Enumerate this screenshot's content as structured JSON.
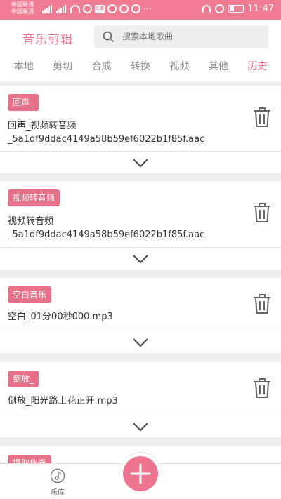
{
  "status_bar": {
    "carrier_1": "中国联通",
    "carrier_2": "中国联通",
    "time": "11:47"
  },
  "header": {
    "title": "音乐剪辑",
    "search_placeholder": "搜索本地歌曲"
  },
  "tabs": [
    {
      "label": "本地"
    },
    {
      "label": "剪切"
    },
    {
      "label": "合成"
    },
    {
      "label": "转换"
    },
    {
      "label": "视频"
    },
    {
      "label": "其他"
    },
    {
      "label": "历史",
      "active": true
    }
  ],
  "items": [
    {
      "tag": "回声_",
      "name_line1": "回声_视频转音频",
      "name_line2": "_5a1df9ddac4149a58b59ef6022b1f85f.aac"
    },
    {
      "tag": "视频转音频",
      "name_line1": "视频转音频",
      "name_line2": "_5a1df9ddac4149a58b59ef6022b1f85f.aac"
    },
    {
      "tag": "空白音乐",
      "name_line1": "空白_01分00秒000.mp3"
    },
    {
      "tag": "倒放_",
      "name_line1": "倒放_阳光路上花正开.mp3"
    },
    {
      "tag": "提取伴奏"
    }
  ],
  "bottom_nav": {
    "library_label": "乐库"
  },
  "colors": {
    "accent": "#ef7490",
    "status_bar": "#f07c93",
    "tag_bg": "#e8718a"
  }
}
